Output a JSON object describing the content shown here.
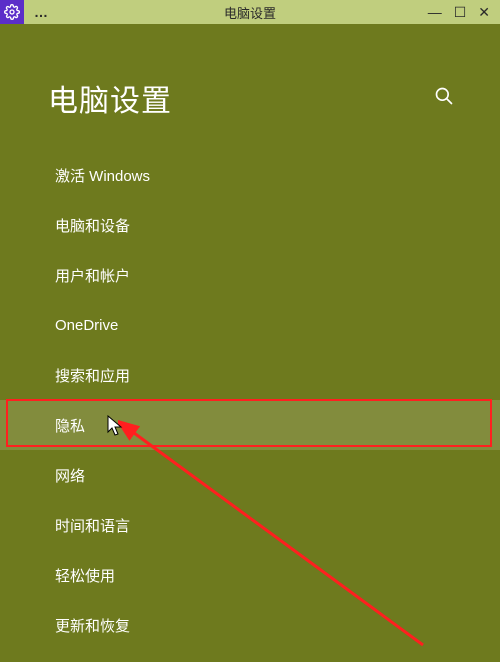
{
  "titlebar": {
    "ellipsis": "…",
    "title": "电脑设置",
    "min": "—",
    "max": "☐",
    "close": "✕"
  },
  "header": {
    "page_title": "电脑设置"
  },
  "nav": {
    "items": [
      "激活 Windows",
      "电脑和设备",
      "用户和帐户",
      "OneDrive",
      "搜索和应用",
      "隐私",
      "网络",
      "时间和语言",
      "轻松使用",
      "更新和恢复"
    ],
    "hover_index": 5
  }
}
